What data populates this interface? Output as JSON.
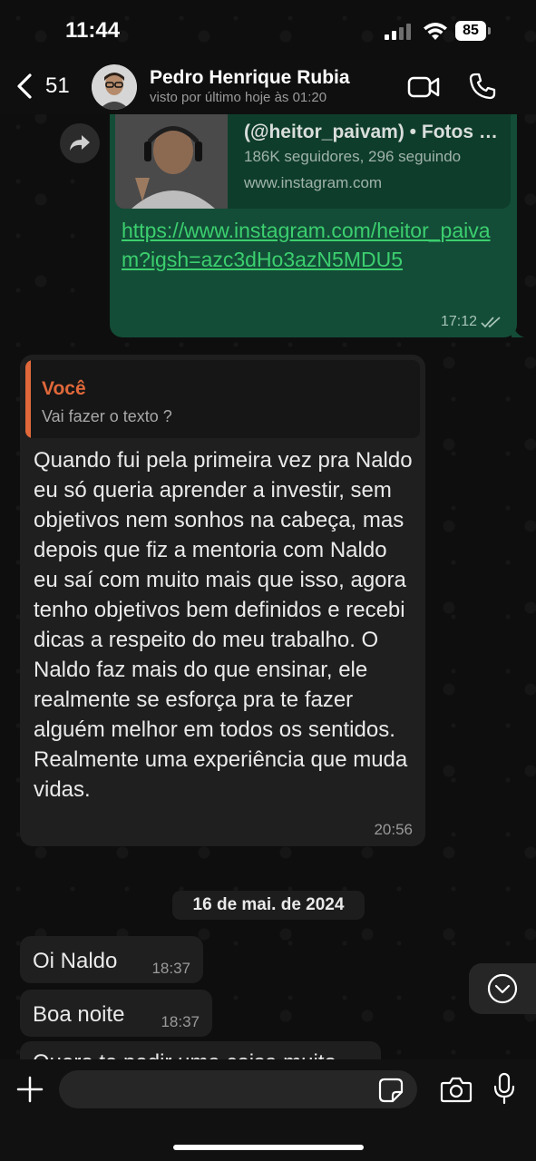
{
  "status_bar": {
    "time": "11:44",
    "battery": "85"
  },
  "header": {
    "back_count": "51",
    "contact_name": "Pedro Henrique Rubia",
    "contact_status": "visto por último hoje às 01:20"
  },
  "outgoing_message": {
    "preview_title": "(@heitor_paivam) • Fotos e vídeos do Instagram",
    "preview_description": "186K seguidores, 296 seguindo",
    "preview_domain": "www.instagram.com",
    "link": "https://www.instagram.com/heitor_paivam?igsh=azc3dHo3azN5MDU5",
    "time": "17:12"
  },
  "reply_message": {
    "quote_author": "Você",
    "quote_text": "Vai fazer o texto ?",
    "text": "Quando fui pela primeira vez pra Naldo eu só queria aprender a investir, sem objetivos nem sonhos na cabeça, mas depois que fiz a mentoria com Naldo eu saí com muito mais que isso, agora tenho objetivos bem definidos e recebi dicas a respeito do meu trabalho. O Naldo faz mais do que ensinar, ele realmente se esforça pra te fazer alguém melhor em todos os sentidos. Realmente uma experiência que muda vidas.",
    "time": "20:56"
  },
  "date_separator": "16 de mai. de 2024",
  "messages": [
    {
      "text": "Oi Naldo",
      "time": "18:37"
    },
    {
      "text": "Boa noite",
      "time": "18:37"
    },
    {
      "text": "Quero te pedir uma coisa muito"
    }
  ],
  "composer": {
    "placeholder": ""
  },
  "colors": {
    "outgoing_bubble": "#134d37",
    "incoming_bubble": "#1f1f1f",
    "link": "#3ccf6f",
    "quote_accent": "#e0683a"
  },
  "icons": [
    "back-chevron-icon",
    "video-call-icon",
    "phone-icon",
    "forward-icon",
    "read-ticks-icon",
    "chevron-down-icon",
    "plus-icon",
    "sticker-icon",
    "camera-icon",
    "mic-icon"
  ]
}
